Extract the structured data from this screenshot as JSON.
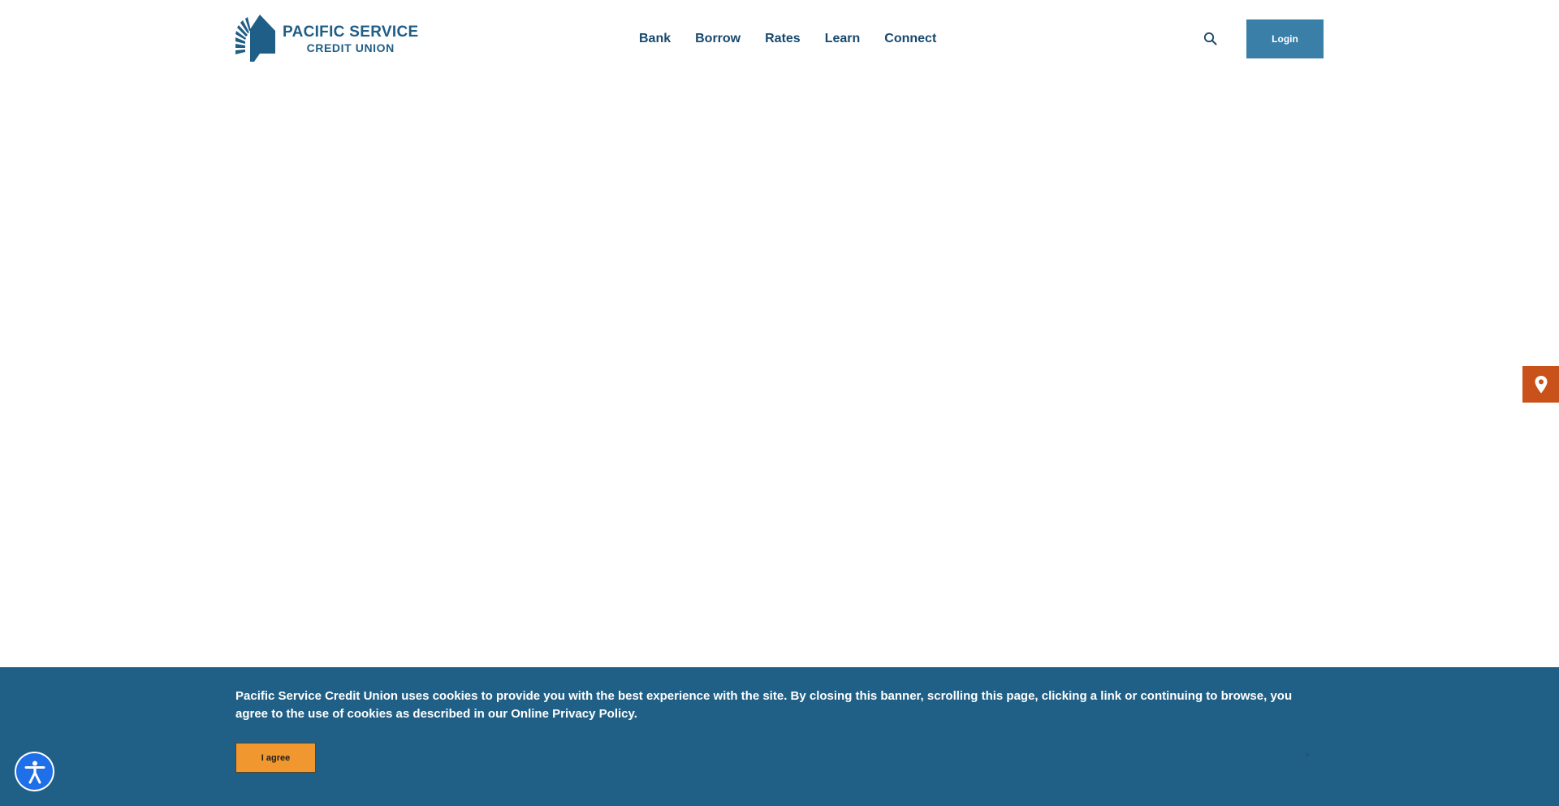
{
  "header": {
    "logo": {
      "line1": "PACIFIC SERVICE",
      "line2": "CREDIT UNION",
      "icon": "sunburst-house-logo",
      "color": "#1f5e86"
    },
    "nav": [
      {
        "label": "Bank"
      },
      {
        "label": "Borrow"
      },
      {
        "label": "Rates"
      },
      {
        "label": "Learn"
      },
      {
        "label": "Connect"
      }
    ],
    "search_icon": "search-icon",
    "login_label": "Login"
  },
  "location_tab": {
    "icon": "map-pin-icon",
    "color": "#c9511a"
  },
  "cookie_banner": {
    "text": "Pacific Service Credit Union uses cookies to provide you with the best experience with the site. By closing this banner, scrolling this page, clicking a link or continuing to browse, you agree to the use of cookies as described in our Online Privacy Policy.",
    "agree_label": "I agree",
    "close_glyph": "×",
    "background": "#216086",
    "button_color": "#f0972f"
  },
  "accessibility": {
    "icon": "accessibility-person-icon",
    "color": "#1e6fe8"
  }
}
